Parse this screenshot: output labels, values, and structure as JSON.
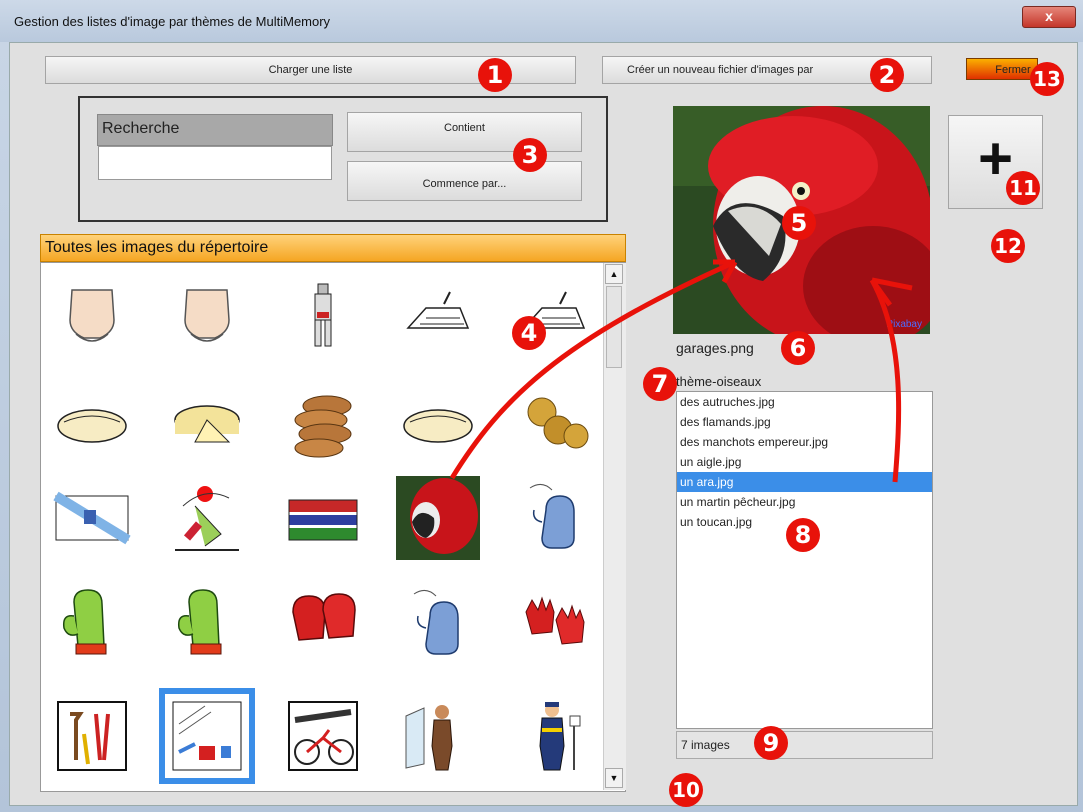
{
  "window": {
    "title": "Gestion des listes d'image par thèmes de MultiMemory",
    "close_label": "x"
  },
  "toolbar": {
    "load_list_label": "Charger une liste",
    "new_file_label": "Créer un nouveau fichier d'images par",
    "close_label": "Fermer"
  },
  "search": {
    "label": "Recherche",
    "value": "",
    "contains_label": "Contient",
    "starts_with_label": "Commence par..."
  },
  "gallery": {
    "header": "Toutes les images du répertoire",
    "items": [
      {
        "icon": "belly-icon"
      },
      {
        "icon": "belly-icon"
      },
      {
        "icon": "knight-armor-icon"
      },
      {
        "icon": "drawing-icon"
      },
      {
        "icon": "drawing-icon"
      },
      {
        "icon": "tortilla-icon"
      },
      {
        "icon": "cheese-icon"
      },
      {
        "icon": "biscuits-icon"
      },
      {
        "icon": "tortilla-icon"
      },
      {
        "icon": "coins-icon"
      },
      {
        "icon": "galicia-flag-icon"
      },
      {
        "icon": "juggler-icon"
      },
      {
        "icon": "gambia-flag-icon"
      },
      {
        "icon": "parrot-photo-icon"
      },
      {
        "icon": "blue-mitten-icon"
      },
      {
        "icon": "green-oven-mitt-icon"
      },
      {
        "icon": "green-oven-mitt-icon"
      },
      {
        "icon": "boxing-gloves-icon"
      },
      {
        "icon": "blue-mitten-icon"
      },
      {
        "icon": "red-gloves-icon"
      },
      {
        "icon": "tools-icon"
      },
      {
        "icon": "workshop-icon"
      },
      {
        "icon": "bicycle-wrench-icon"
      },
      {
        "icon": "mechanic-icon"
      },
      {
        "icon": "worker-icon"
      }
    ]
  },
  "preview": {
    "filename": "garages.png",
    "watermark": "Pixabay"
  },
  "theme_list": {
    "title": "thème-oiseaux",
    "items": [
      "des autruches.jpg",
      "des flamands.jpg",
      "des manchots empereur.jpg",
      "un aigle.jpg",
      "un ara.jpg",
      "un martin pêcheur.jpg",
      "un toucan.jpg"
    ],
    "selected_index": 4,
    "count_label": "7 images"
  },
  "add_button_label": "+",
  "annotations": [
    "1",
    "2",
    "3",
    "4",
    "5",
    "6",
    "7",
    "8",
    "9",
    "10",
    "11",
    "12",
    "13"
  ],
  "colors": {
    "annotation_red": "#e8120a",
    "gallery_header": "#f5a623",
    "selection_blue": "#3b8ee8"
  }
}
